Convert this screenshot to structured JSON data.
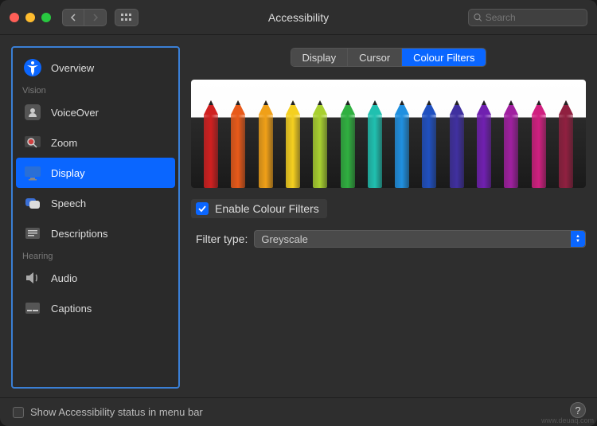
{
  "window": {
    "title": "Accessibility"
  },
  "search": {
    "placeholder": "Search"
  },
  "sidebar": {
    "overview": "Overview",
    "section_vision": "Vision",
    "voiceover": "VoiceOver",
    "zoom": "Zoom",
    "display": "Display",
    "speech": "Speech",
    "descriptions": "Descriptions",
    "section_hearing": "Hearing",
    "audio": "Audio",
    "captions": "Captions"
  },
  "tabs": {
    "display": "Display",
    "cursor": "Cursor",
    "colour_filters": "Colour Filters"
  },
  "pencil_colors": [
    "#d02020",
    "#e85a1a",
    "#f0a018",
    "#f5d020",
    "#a8d030",
    "#30b040",
    "#20c0b0",
    "#2090e0",
    "#2050c0",
    "#4030a0",
    "#7020b0",
    "#a020a0",
    "#d02080",
    "#902040"
  ],
  "form": {
    "enable_label": "Enable Colour Filters",
    "filter_type_label": "Filter type:",
    "filter_type_value": "Greyscale"
  },
  "footer": {
    "menubar_label": "Show Accessibility status in menu bar"
  },
  "watermark": "www.deuaq.com"
}
